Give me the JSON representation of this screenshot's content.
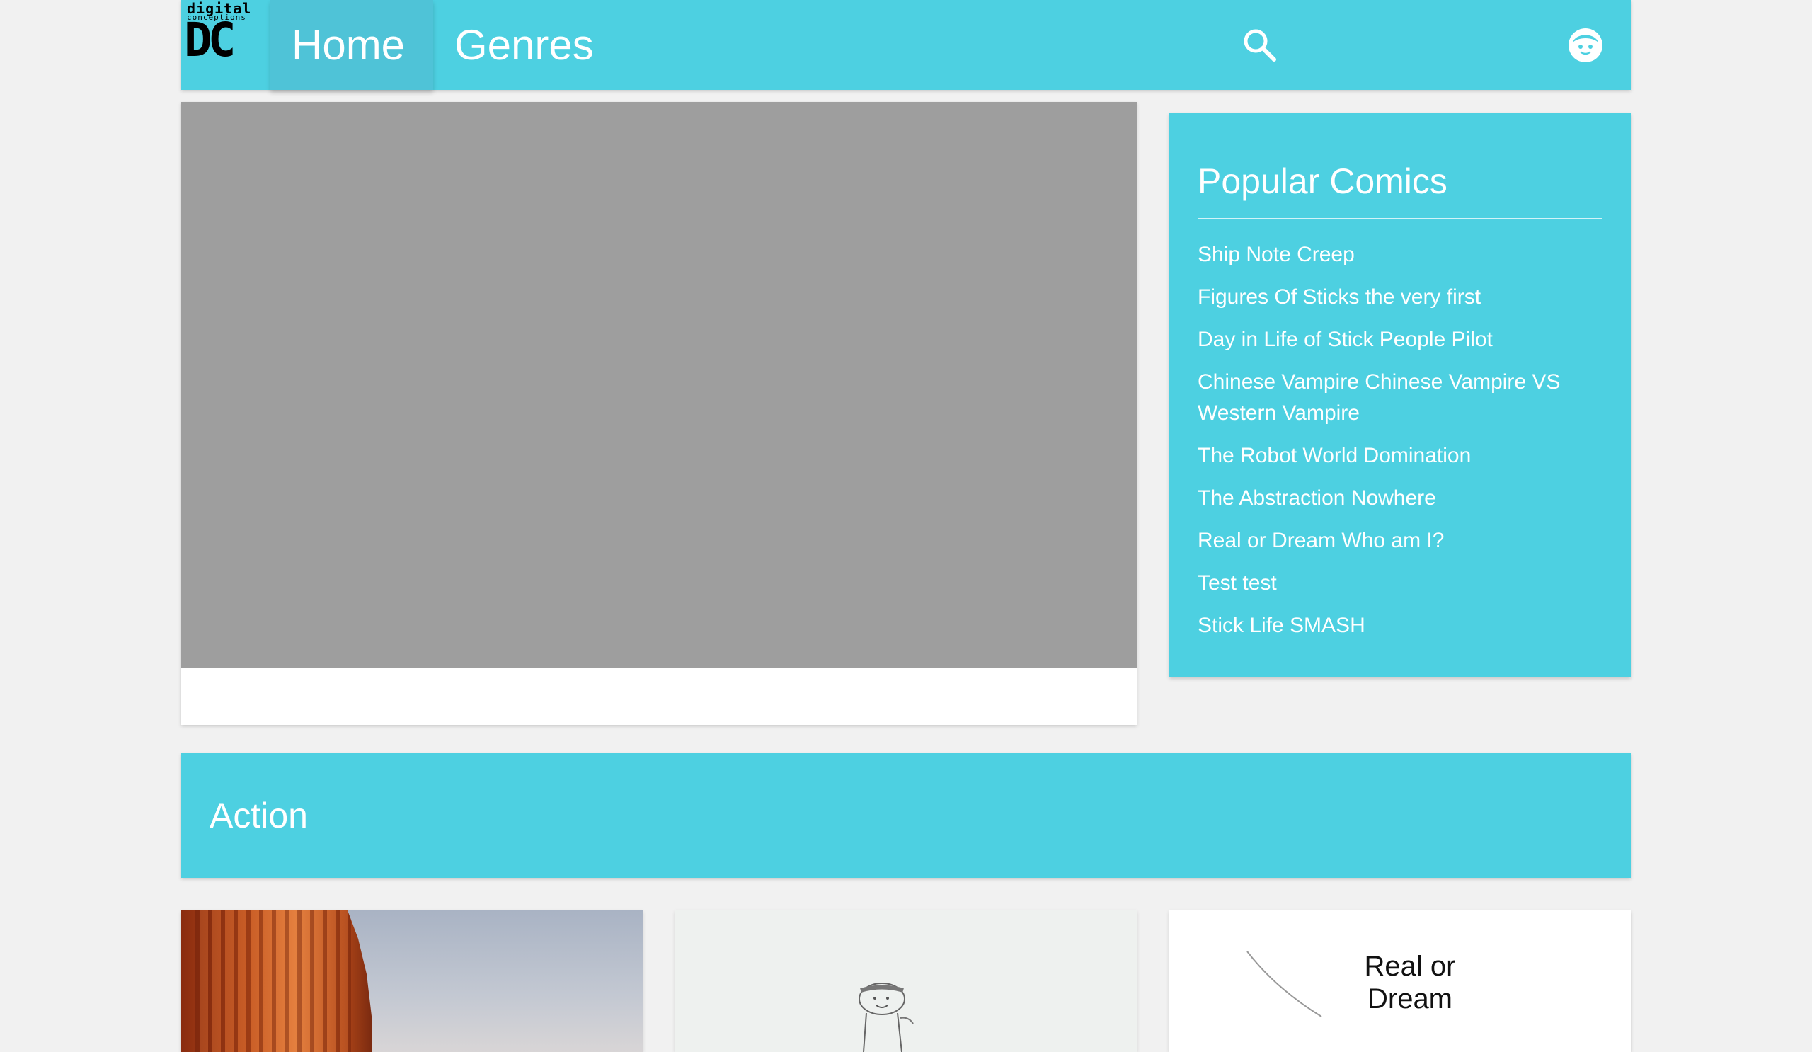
{
  "logo": {
    "top_text": "digital",
    "sub_text": "conceptions",
    "mark": "DC"
  },
  "nav": {
    "home_label": "Home",
    "genres_label": "Genres",
    "search_icon": "search-icon",
    "account_icon": "face-icon"
  },
  "popular": {
    "title": "Popular Comics",
    "items": [
      "Ship Note Creep",
      "Figures Of Sticks the very first",
      "Day in Life of Stick People Pilot",
      "Chinese Vampire Chinese Vampire VS Western Vampire",
      "The Robot World Domination",
      "The Abstraction Nowhere",
      "Real or Dream Who am I?",
      "Test test",
      "Stick Life SMASH"
    ]
  },
  "genre": {
    "title": "Action"
  },
  "cards": {
    "card3_text": "Real or Dream"
  },
  "colors": {
    "accent": "#4dd0e1",
    "hero_placeholder": "#9e9e9e",
    "page_bg": "#f1f1f1"
  }
}
